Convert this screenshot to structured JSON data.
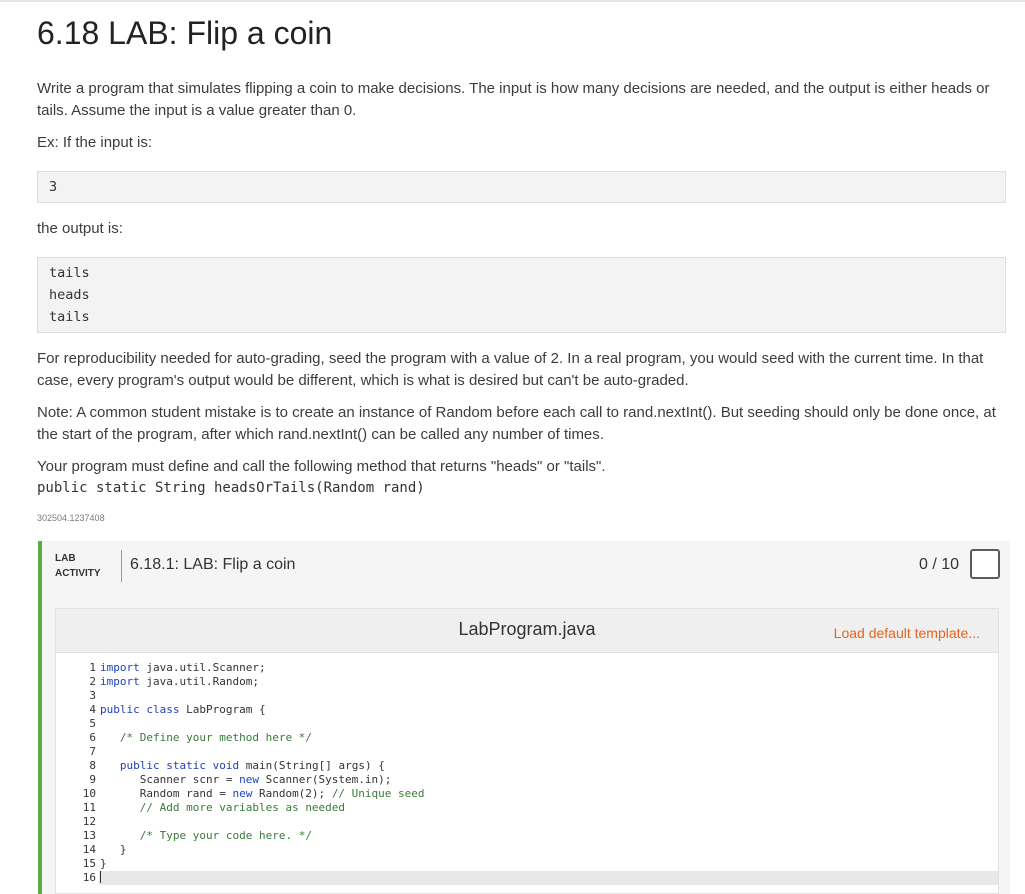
{
  "page": {
    "title": "6.18 LAB: Flip a coin",
    "intro": "Write a program that simulates flipping a coin to make decisions. The input is how many decisions are needed, and the output is either heads or tails. Assume the input is a value greater than 0.",
    "example_label": "Ex: If the input is:",
    "example_input": "3",
    "output_label": "the output is:",
    "example_output": [
      "tails",
      "heads",
      "tails"
    ],
    "reproducibility": "For reproducibility needed for auto-grading, seed the program with a value of 2. In a real program, you would seed with the current time. In that case, every program's output would be different, which is what is desired but can't be auto-graded.",
    "note": "Note: A common student mistake is to create an instance of Random before each call to rand.nextInt(). But seeding should only be done once, at the start of the program, after which rand.nextInt() can be called any number of times.",
    "method_text": "Your program must define and call the following method that returns \"heads\" or \"tails\".",
    "method_signature": "public static String headsOrTails(Random rand)",
    "id_code": "302504.1237408"
  },
  "lab": {
    "tag_line1": "LAB",
    "tag_line2": "ACTIVITY",
    "name": "6.18.1: LAB: Flip a coin",
    "score": "0 / 10",
    "accent_color": "#5aaa46"
  },
  "editor": {
    "filename": "LabProgram.java",
    "load_template": "Load default template...",
    "line_numbers": [
      "1",
      "2",
      "3",
      "4",
      "5",
      "6",
      "7",
      "8",
      "9",
      "10",
      "11",
      "12",
      "13",
      "14",
      "15",
      "16"
    ],
    "lines": [
      "import java.util.Scanner;",
      "import java.util.Random;",
      "",
      "public class LabProgram {",
      "",
      "   /* Define your method here */",
      "",
      "   public static void main(String[] args) {",
      "      Scanner scnr = new Scanner(System.in);",
      "      Random rand = new Random(2); // Unique seed",
      "      // Add more variables as needed",
      "",
      "      /* Type your code here. */",
      "   }",
      "}",
      ""
    ]
  }
}
